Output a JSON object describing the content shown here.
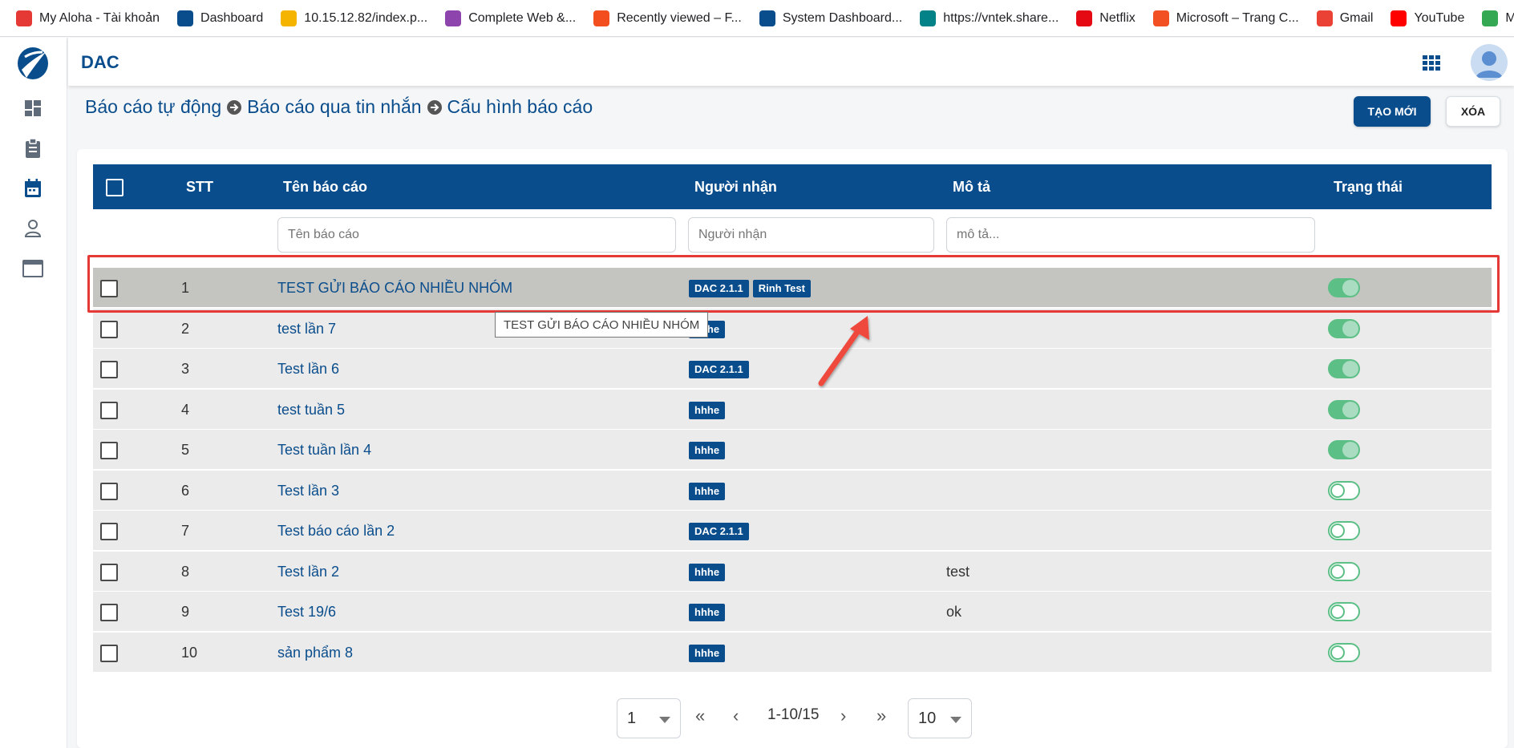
{
  "bookmarks": [
    {
      "label": "My Aloha - Tài khoản",
      "icon": "aloha-icon",
      "color": "#e53935"
    },
    {
      "label": "Dashboard",
      "icon": "fpt-icon",
      "color": "#0a4d8c"
    },
    {
      "label": "10.15.12.82/index.p...",
      "icon": "site-icon",
      "color": "#f4b400"
    },
    {
      "label": "Complete Web &...",
      "icon": "udemy-icon",
      "color": "#8e44ad"
    },
    {
      "label": "Recently viewed – F...",
      "icon": "figma-icon",
      "color": "#f24e1e"
    },
    {
      "label": "System Dashboard...",
      "icon": "fpt-icon",
      "color": "#0a4d8c"
    },
    {
      "label": "https://vntek.share...",
      "icon": "sharepoint-icon",
      "color": "#038387"
    },
    {
      "label": "Netflix",
      "icon": "netflix-icon",
      "color": "#e50914"
    },
    {
      "label": "Microsoft – Trang C...",
      "icon": "microsoft-icon",
      "color": "#f25022"
    },
    {
      "label": "Gmail",
      "icon": "gmail-icon",
      "color": "#ea4335"
    },
    {
      "label": "YouTube",
      "icon": "youtube-icon",
      "color": "#ff0000"
    },
    {
      "label": "Maps",
      "icon": "maps-icon",
      "color": "#34a853"
    }
  ],
  "header": {
    "title": "DAC"
  },
  "breadcrumb": [
    "Báo cáo tự động",
    "Báo cáo qua tin nhắn",
    "Cấu hình báo cáo"
  ],
  "actions": {
    "create": "TẠO MỚI",
    "delete": "XÓA"
  },
  "table": {
    "columns": {
      "stt": "STT",
      "name": "Tên báo cáo",
      "recipient": "Người nhận",
      "desc": "Mô tả",
      "status": "Trạng thái"
    },
    "filters": {
      "name": "Tên báo cáo",
      "recipient": "Người nhận",
      "desc": "mô tả..."
    },
    "rows": [
      {
        "stt": "1",
        "name": "TEST GỬI BÁO CÁO NHIỀU NHÓM",
        "tags": [
          "DAC 2.1.1",
          "Rinh Test"
        ],
        "desc": "",
        "active": true
      },
      {
        "stt": "2",
        "name": "test lần 7",
        "tags": [
          "hhhe"
        ],
        "desc": "",
        "active": true
      },
      {
        "stt": "3",
        "name": "Test lần 6",
        "tags": [
          "DAC 2.1.1"
        ],
        "desc": "",
        "active": true
      },
      {
        "stt": "4",
        "name": "test tuần 5",
        "tags": [
          "hhhe"
        ],
        "desc": "",
        "active": true
      },
      {
        "stt": "5",
        "name": "Test tuần lần 4",
        "tags": [
          "hhhe"
        ],
        "desc": "",
        "active": true
      },
      {
        "stt": "6",
        "name": "Test lần 3",
        "tags": [
          "hhhe"
        ],
        "desc": "",
        "active": false
      },
      {
        "stt": "7",
        "name": "Test báo cáo lần 2",
        "tags": [
          "DAC 2.1.1"
        ],
        "desc": "",
        "active": false
      },
      {
        "stt": "8",
        "name": "Test lần 2",
        "tags": [
          "hhhe"
        ],
        "desc": "test",
        "active": false
      },
      {
        "stt": "9",
        "name": "Test 19/6",
        "tags": [
          "hhhe"
        ],
        "desc": "ok",
        "active": false
      },
      {
        "stt": "10",
        "name": "sản phẩm 8",
        "tags": [
          "hhhe"
        ],
        "desc": "",
        "active": false
      }
    ]
  },
  "tooltip": "TEST GỬI BÁO CÁO NHIỀU NHÓM",
  "pagination": {
    "page": "1",
    "range": "1-10/15",
    "page_size": "10"
  },
  "colors": {
    "primary": "#0a4d8c",
    "toggle": "#5cbf86",
    "highlight": "#e53935"
  }
}
